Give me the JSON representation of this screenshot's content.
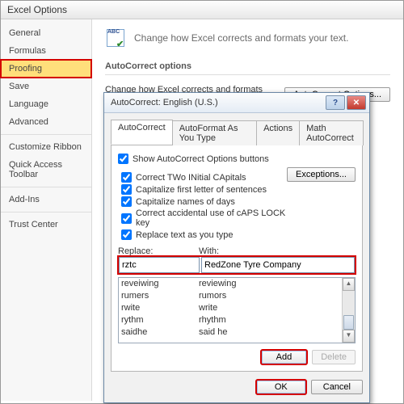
{
  "optionsTitle": "Excel Options",
  "sidebar": {
    "items": [
      "General",
      "Formulas",
      "Proofing",
      "Save",
      "Language",
      "Advanced",
      "Customize Ribbon",
      "Quick Access Toolbar",
      "Add-Ins",
      "Trust Center"
    ],
    "selectedIndex": 2
  },
  "headerIconText": "ABC",
  "headerText": "Change how Excel corrects and formats your text.",
  "sectionTitle": "AutoCorrect options",
  "sectionRowText": "Change how Excel corrects and formats text as you type:",
  "autoCorrectOptionsBtn": "AutoCorrect Options...",
  "dialog": {
    "title": "AutoCorrect: English (U.S.)",
    "tabs": [
      "AutoCorrect",
      "AutoFormat As You Type",
      "Actions",
      "Math AutoCorrect"
    ],
    "activeTab": 0,
    "showButtonsLabel": "Show AutoCorrect Options buttons",
    "checks": [
      "Correct TWo INitial CApitals",
      "Capitalize first letter of sentences",
      "Capitalize names of days",
      "Correct accidental use of cAPS LOCK key",
      "Replace text as you type"
    ],
    "exceptionsBtn": "Exceptions...",
    "replaceLabel": "Replace:",
    "withLabel": "With:",
    "replaceValue": "rztc",
    "withValue": "RedZone Tyre Company",
    "list": [
      {
        "r": "reveiwing",
        "w": "reviewing"
      },
      {
        "r": "rumers",
        "w": "rumors"
      },
      {
        "r": "rwite",
        "w": "write"
      },
      {
        "r": "rythm",
        "w": "rhythm"
      },
      {
        "r": "saidhe",
        "w": "said he"
      }
    ],
    "addBtn": "Add",
    "deleteBtn": "Delete",
    "okBtn": "OK",
    "cancelBtn": "Cancel"
  }
}
